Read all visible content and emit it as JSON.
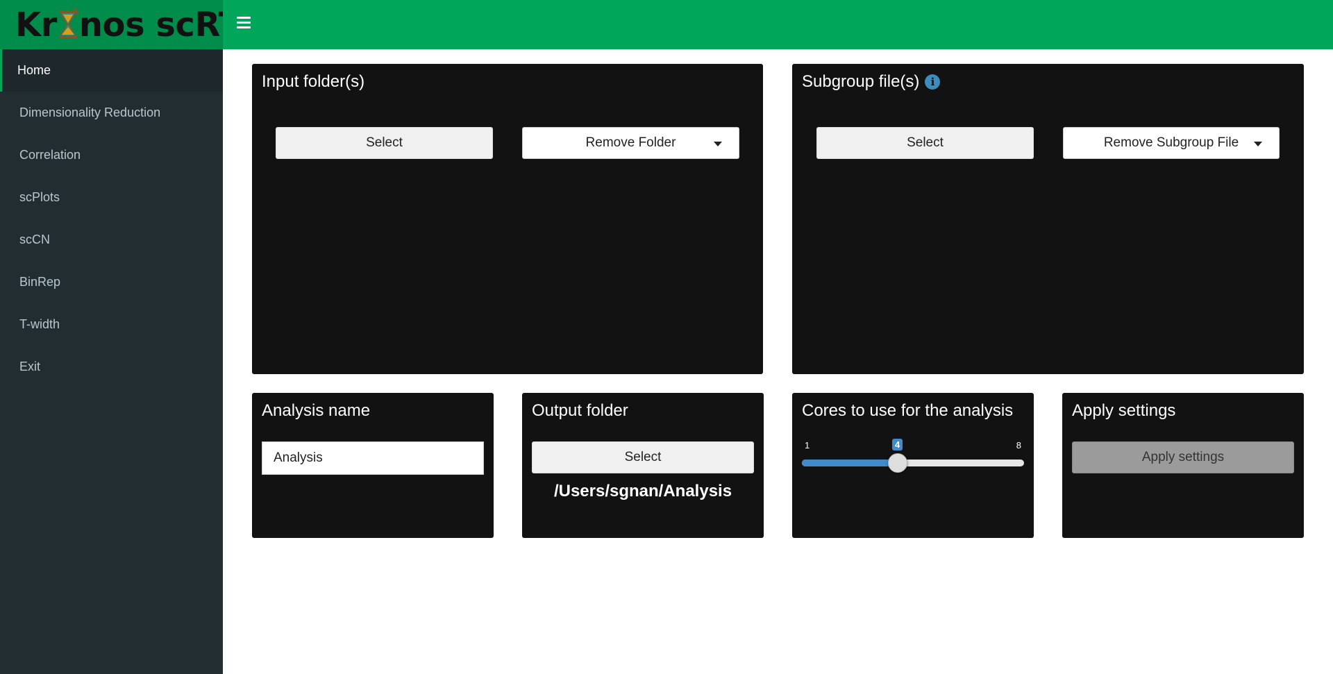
{
  "header": {
    "logo_prefix": "Kr",
    "logo_suffix": "nos scRT",
    "menu_icon": "hamburger-icon",
    "colors": {
      "header": "#00a65a",
      "logo_bg": "#008d4c",
      "sidebar": "#222d32"
    }
  },
  "sidebar": {
    "items": [
      {
        "label": "Home",
        "active": true
      },
      {
        "label": "Dimensionality Reduction"
      },
      {
        "label": "Correlation"
      },
      {
        "label": "scPlots"
      },
      {
        "label": "scCN"
      },
      {
        "label": "BinRep"
      },
      {
        "label": "T-width"
      },
      {
        "label": "Exit"
      }
    ]
  },
  "input_folders": {
    "title": "Input folder(s)",
    "select_label": "Select",
    "remove_label": "Remove Folder"
  },
  "subgroup_files": {
    "title": "Subgroup file(s)",
    "info_icon": "info-icon",
    "select_label": "Select",
    "remove_label": "Remove Subgroup File"
  },
  "analysis_name": {
    "title": "Analysis name",
    "value": "Analysis"
  },
  "output_folder": {
    "title": "Output folder",
    "select_label": "Select",
    "path": "/Users/sgnan/Analysis"
  },
  "cores": {
    "title": "Cores to use for the analysis",
    "min": 1,
    "max": 8,
    "value": 4,
    "min_label": "1",
    "max_label": "8",
    "value_label": "4",
    "accent": "#428bca"
  },
  "apply": {
    "title": "Apply settings",
    "button_label": "Apply settings"
  }
}
